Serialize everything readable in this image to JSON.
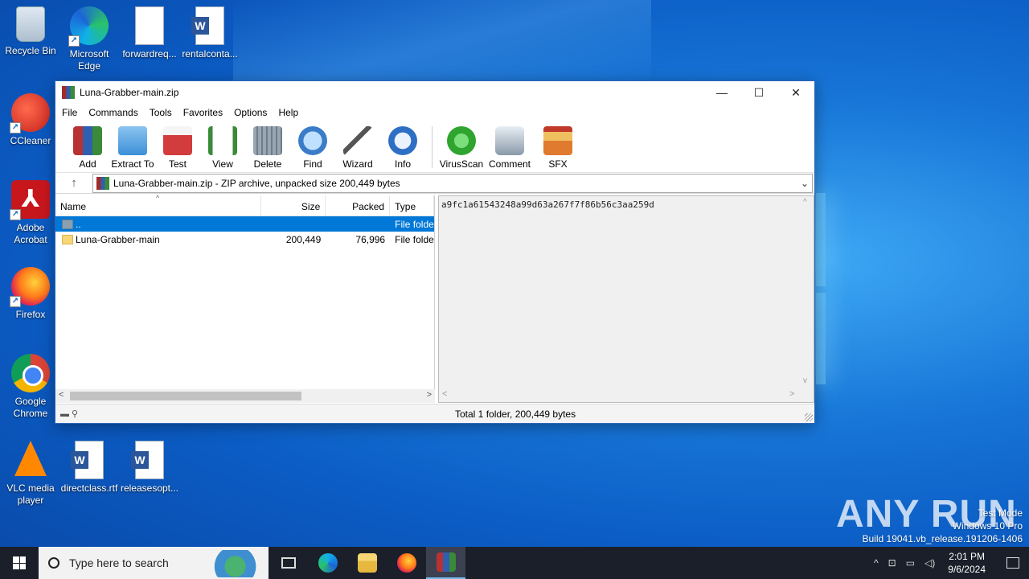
{
  "desktop": {
    "icons": [
      {
        "label": "Recycle Bin",
        "icon": "recycle-bin-icon"
      },
      {
        "label": "Microsoft Edge",
        "icon": "edge-icon"
      },
      {
        "label": "forwardreq...",
        "icon": "image-file-icon"
      },
      {
        "label": "rentalconta...",
        "icon": "word-doc-icon"
      },
      {
        "label": "CCleaner",
        "icon": "ccleaner-icon"
      },
      {
        "label": "Adobe Acrobat",
        "icon": "acrobat-icon"
      },
      {
        "label": "Firefox",
        "icon": "firefox-icon"
      },
      {
        "label": "Google Chrome",
        "icon": "chrome-icon"
      },
      {
        "label": "VLC media player",
        "icon": "vlc-icon"
      },
      {
        "label": "directclass.rtf",
        "icon": "word-doc-icon"
      },
      {
        "label": "releasesopt...",
        "icon": "word-doc-icon"
      }
    ]
  },
  "window": {
    "title": "Luna-Grabber-main.zip",
    "menu": [
      "File",
      "Commands",
      "Tools",
      "Favorites",
      "Options",
      "Help"
    ],
    "toolbar": [
      {
        "label": "Add",
        "color": "#c0392b"
      },
      {
        "label": "Extract To",
        "color": "#3b8fd8"
      },
      {
        "label": "Test",
        "color": "#d23c3c"
      },
      {
        "label": "View",
        "color": "#3a8a3a"
      },
      {
        "label": "Delete",
        "color": "#7f8c99"
      },
      {
        "label": "Find",
        "color": "#3a7cc8"
      },
      {
        "label": "Wizard",
        "color": "#b07ad0"
      },
      {
        "label": "Info",
        "color": "#2d6fc4"
      },
      {
        "label": "VirusScan",
        "color": "#2fa52f"
      },
      {
        "label": "Comment",
        "color": "#8a9aaa"
      },
      {
        "label": "SFX",
        "color": "#e07a2f"
      }
    ],
    "address": "Luna-Grabber-main.zip - ZIP archive, unpacked size 200,449 bytes",
    "columns": {
      "name": "Name",
      "size": "Size",
      "packed": "Packed",
      "type": "Type"
    },
    "rows": [
      {
        "name": "..",
        "size": "",
        "packed": "",
        "type": "File folder"
      },
      {
        "name": "Luna-Grabber-main",
        "size": "200,449",
        "packed": "76,996",
        "type": "File folder"
      }
    ],
    "comment_text": "a9fc1a61543248a99d63a267f7f86b56c3aa259d",
    "status": "Total 1 folder, 200,449 bytes"
  },
  "watermark": {
    "logo": "ANY RUN",
    "line1": "Test Mode",
    "line2": "Windows 10 Pro",
    "line3": "Build 19041.vb_release.191206-1406"
  },
  "taskbar": {
    "search_placeholder": "Type here to search",
    "time": "2:01 PM",
    "date": "9/6/2024"
  }
}
